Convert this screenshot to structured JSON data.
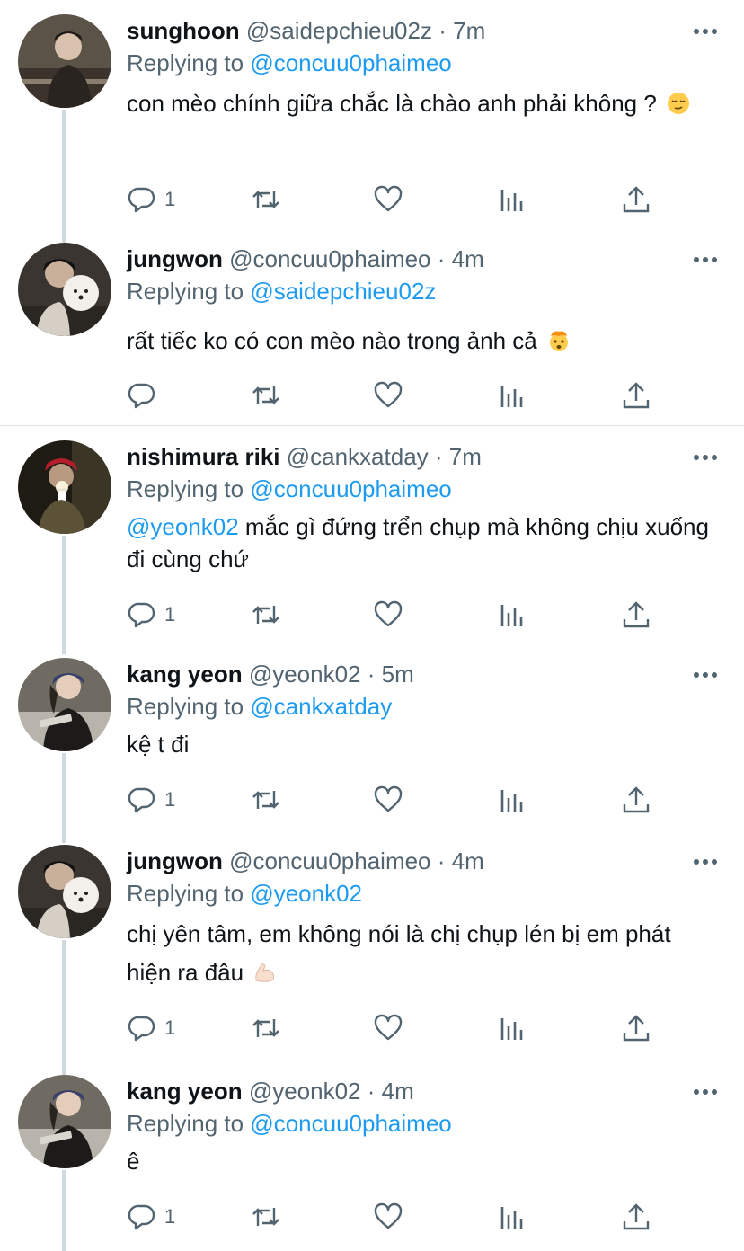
{
  "tweets": [
    {
      "name": "sunghoon",
      "handle": "@saidepchieu02z",
      "sep": "·",
      "time": "7m",
      "replying_label": "Replying to",
      "replying_to": "@concuu0phaimeo",
      "text": "con mèo chính giữa chắc là chào anh phải không ?",
      "mention": "",
      "emoji": "relieved-face",
      "reply_count": "1"
    },
    {
      "name": "jungwon",
      "handle": "@concuu0phaimeo",
      "sep": "·",
      "time": "4m",
      "replying_label": "Replying to",
      "replying_to": "@saidepchieu02z",
      "text": "rất tiếc ko có con mèo nào trong ảnh cả",
      "mention": "",
      "emoji": "exploding-head",
      "reply_count": ""
    },
    {
      "name": "nishimura riki",
      "handle": "@cankxatday",
      "sep": "·",
      "time": "7m",
      "replying_label": "Replying to",
      "replying_to": "@concuu0phaimeo",
      "text": " mắc gì đứng trển chụp mà không chịu xuống đi cùng chứ",
      "mention": "@yeonk02",
      "emoji": "",
      "reply_count": "1"
    },
    {
      "name": "kang yeon",
      "handle": "@yeonk02",
      "sep": "·",
      "time": "5m",
      "replying_label": "Replying to",
      "replying_to": "@cankxatday",
      "text": "kệ t đi",
      "mention": "",
      "emoji": "",
      "reply_count": "1"
    },
    {
      "name": "jungwon",
      "handle": "@concuu0phaimeo",
      "sep": "·",
      "time": "4m",
      "replying_label": "Replying to",
      "replying_to": "@yeonk02",
      "text": "chị yên tâm, em không nói là chị chụp lén bị em phát hiện ra đâu",
      "mention": "",
      "emoji": "flexed-biceps",
      "reply_count": "1"
    },
    {
      "name": "kang yeon",
      "handle": "@yeonk02",
      "sep": "·",
      "time": "4m",
      "replying_label": "Replying to",
      "replying_to": "@concuu0phaimeo",
      "text": "ê",
      "mention": "",
      "emoji": "",
      "reply_count": "1"
    }
  ],
  "icons": {
    "reply": "reply-icon",
    "retweet": "retweet-icon",
    "like": "heart-icon",
    "analytics": "analytics-icon",
    "share": "share-icon",
    "more": "more-icon"
  },
  "colors": {
    "link": "#1d9bf0",
    "secondary_text": "#536471",
    "thread_line": "#cfd9de"
  }
}
